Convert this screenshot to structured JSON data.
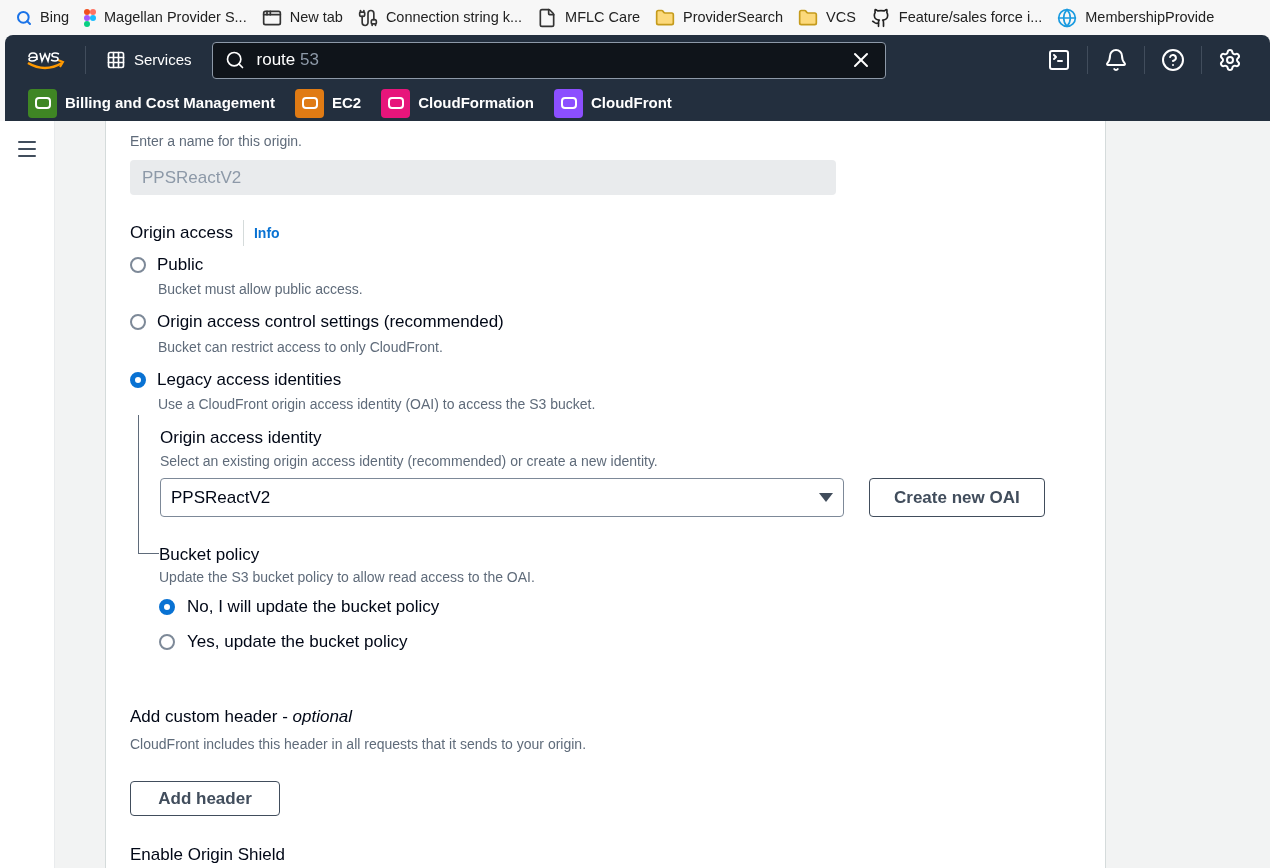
{
  "bookmarks": [
    {
      "kind": "bing",
      "label": "Bing"
    },
    {
      "kind": "figma",
      "label": "Magellan Provider S..."
    },
    {
      "kind": "newtab",
      "label": "New tab"
    },
    {
      "kind": "connection",
      "label": "Connection string k..."
    },
    {
      "kind": "file",
      "label": "MFLC Care"
    },
    {
      "kind": "folder",
      "label": "ProviderSearch"
    },
    {
      "kind": "folder",
      "label": "VCS"
    },
    {
      "kind": "github",
      "label": "Feature/sales force i..."
    },
    {
      "kind": "globe",
      "label": "MembershipProvide"
    }
  ],
  "header": {
    "services": "Services",
    "search": {
      "query": "route",
      "suggestion": "53"
    }
  },
  "favorites": [
    {
      "color": "#3f8624",
      "label": "Billing and Cost Management"
    },
    {
      "color": "#e07b14",
      "label": "EC2"
    },
    {
      "color": "#e7157b",
      "label": "CloudFormation"
    },
    {
      "color": "#8c4fff",
      "label": "CloudFront"
    }
  ],
  "form": {
    "name_hint": "Enter a name for this origin.",
    "name_value": "PPSReactV2",
    "origin_access": {
      "label": "Origin access",
      "info": "Info",
      "options": [
        {
          "label": "Public",
          "description": "Bucket must allow public access.",
          "selected": false
        },
        {
          "label": "Origin access control settings (recommended)",
          "description": "Bucket can restrict access to only CloudFront.",
          "selected": false
        },
        {
          "label": "Legacy access identities",
          "description": "Use a CloudFront origin access identity (OAI) to access the S3 bucket.",
          "selected": true
        }
      ]
    },
    "identity": {
      "label": "Origin access identity",
      "description": "Select an existing origin access identity (recommended) or create a new identity.",
      "value": "PPSReactV2",
      "button": "Create new OAI"
    },
    "bucket_policy": {
      "label": "Bucket policy",
      "description": "Update the S3 bucket policy to allow read access to the OAI.",
      "options": [
        {
          "label": "No, I will update the bucket policy",
          "selected": true
        },
        {
          "label": "Yes, update the bucket policy",
          "selected": false
        }
      ]
    },
    "custom_header": {
      "label": "Add custom header - ",
      "optional": "optional",
      "description": "CloudFront includes this header in all requests that it sends to your origin.",
      "button": "Add header"
    },
    "origin_shield": {
      "label": "Enable Origin Shield"
    }
  }
}
